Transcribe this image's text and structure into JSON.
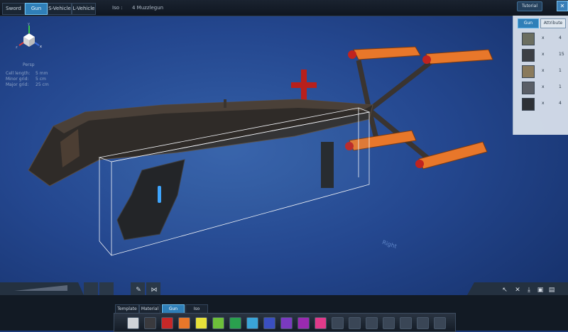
{
  "topbar": {
    "tabs": [
      {
        "label": "Sword",
        "active": false
      },
      {
        "label": "Gun",
        "active": true
      },
      {
        "label": "S-Vehicle",
        "active": false
      },
      {
        "label": "L-Vehicle",
        "active": false
      }
    ],
    "iso_label": "Iso :",
    "file_name": "4 Muzzlegun",
    "tutorial_label": "Tutorial",
    "close_glyph": "✕"
  },
  "viewport": {
    "view_mode": "Persp",
    "grid_info": [
      {
        "key": "Cell length:",
        "value": "5 mm"
      },
      {
        "key": "Minor grid:",
        "value": "5 cm"
      },
      {
        "key": "Major grid:",
        "value": "25 cm"
      }
    ],
    "gizmo_axes": {
      "y": "y",
      "z": "z",
      "x": "x"
    },
    "axis_label": "Right"
  },
  "right_panel": {
    "tabs": [
      {
        "label": "Gun",
        "active": true
      },
      {
        "label": "Attribute",
        "active": false
      }
    ],
    "materials": [
      {
        "x": "x",
        "count": "4",
        "color": "#6b6e60"
      },
      {
        "x": "x",
        "count": "15",
        "color": "#3c3f44"
      },
      {
        "x": "x",
        "count": "1",
        "color": "#8a7a5c"
      },
      {
        "x": "x",
        "count": "1",
        "color": "#5a5e66"
      },
      {
        "x": "x",
        "count": "4",
        "color": "#2e3136"
      }
    ]
  },
  "bottom": {
    "category_tabs": [
      {
        "label": "Template",
        "active": false
      },
      {
        "label": "Material",
        "active": false
      },
      {
        "label": "Gun",
        "active": true
      },
      {
        "label": "Iso",
        "active": false
      }
    ],
    "swatches": [
      "#cfd3d8",
      "#3a3a3e",
      "#c62828",
      "#e8772a",
      "#e6e03a",
      "#6dbf3a",
      "#2aa04e",
      "#3aa4d8",
      "#3a4fc0",
      "#7a3ac0",
      "#9a2ab0",
      "#e03a8a",
      "#3a4656",
      "#3a4656",
      "#3a4656",
      "#3a4656",
      "#3a4656",
      "#3a4656",
      "#3a4656"
    ],
    "tool_icons": [
      "cursor",
      "scissors",
      "cross",
      "download",
      "image",
      "save"
    ]
  },
  "colors": {
    "accent": "#2f7fb8",
    "frame": "#f2f4f8",
    "orange": "#e8772a",
    "red": "#c0231f"
  }
}
